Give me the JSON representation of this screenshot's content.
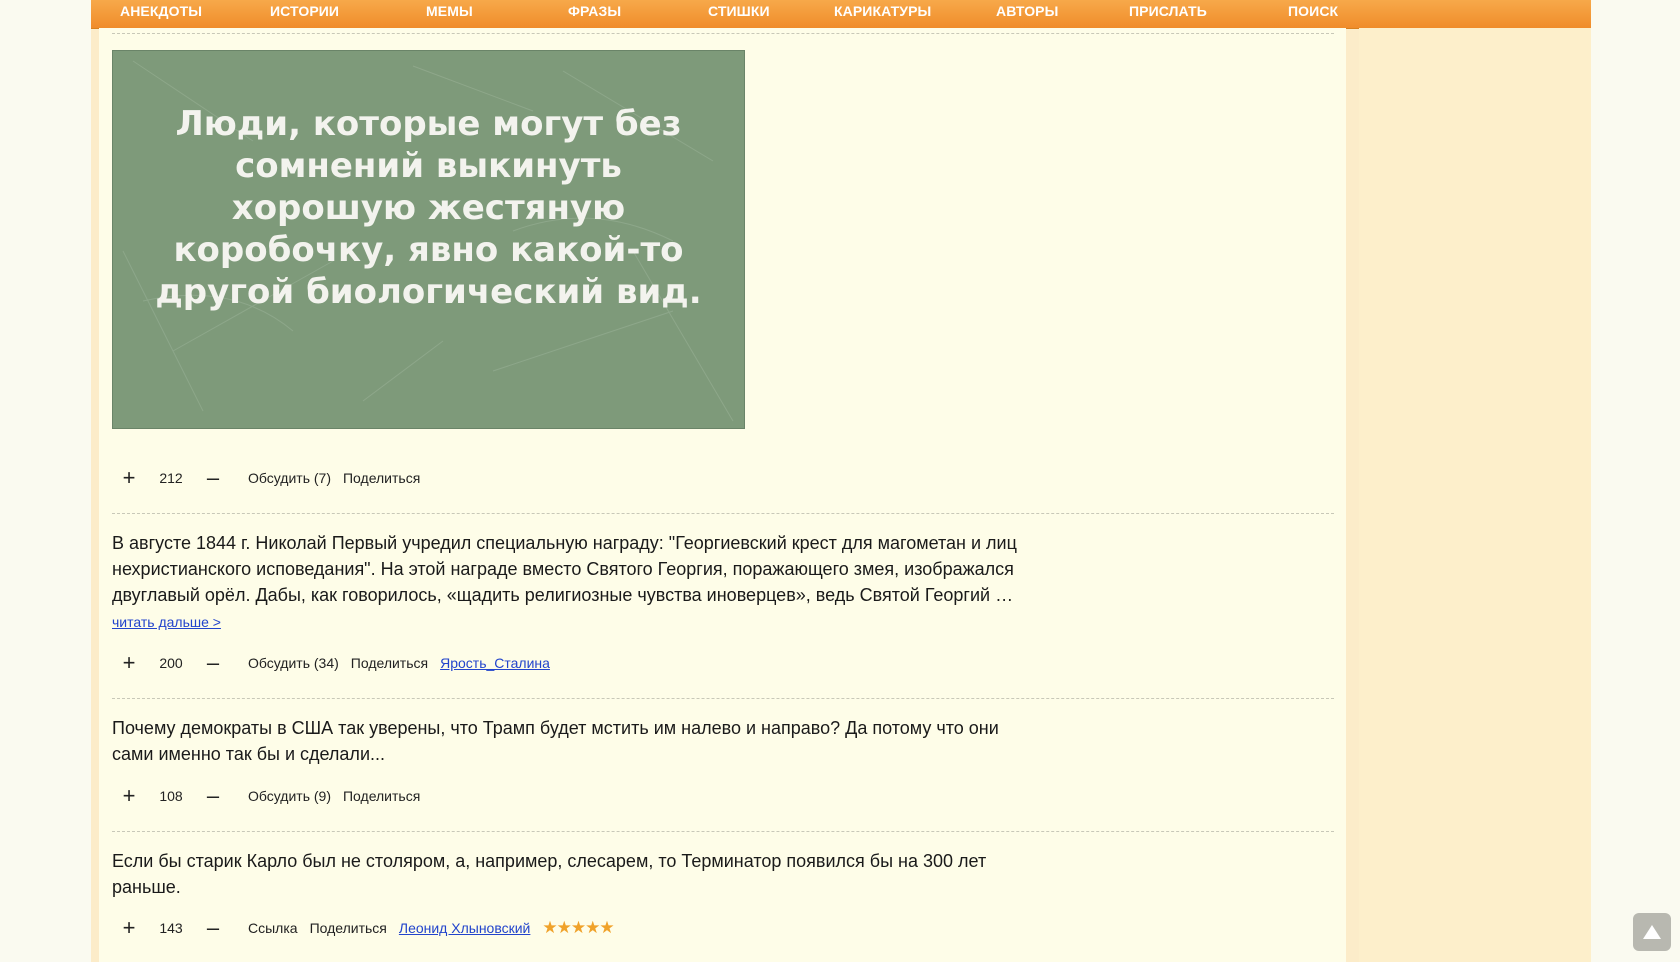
{
  "nav": [
    {
      "label": "АНЕКДОТЫ"
    },
    {
      "label": "ИСТОРИИ"
    },
    {
      "label": "МЕМЫ"
    },
    {
      "label": "ФРАЗЫ"
    },
    {
      "label": "СТИШКИ"
    },
    {
      "label": "КАРИКАТУРЫ"
    },
    {
      "label": "АВТОРЫ"
    },
    {
      "label": "ПРИСЛАТЬ"
    },
    {
      "label": "ПОИСК"
    }
  ],
  "meme": {
    "text": "Люди, которые могут без\nсомнений выкинуть\nхорошую жестяную\nкоробочку, явно какой-то\nдругой биологический вид."
  },
  "posts": [
    {
      "score": "212",
      "discuss": "Обсудить (7)",
      "share": "Поделиться"
    },
    {
      "text": "В августе 1844 г. Николай Первый учредил специальную награду: \"Георгиевский крест для магометан и лиц нехристианского исповедания\". На этой награде вместо Святого Георгия, поражающего змея, изображался двуглавый орёл. Дабы, как говорилось, «щадить религиозные чувства иноверцев», ведь Святой Георгий …",
      "read_more": "читать дальше >",
      "score": "200",
      "discuss": "Обсудить (34)",
      "share": "Поделиться",
      "author": "Ярость_Сталина"
    },
    {
      "text": "Почему демократы в США так уверены, что Трамп будет мстить им налево и направо? Да потому что они сами именно так бы и сделали...",
      "score": "108",
      "discuss": "Обсудить (9)",
      "share": "Поделиться"
    },
    {
      "text": "Если бы старик Карло был не столяром, а, например, слесарем, то Терминатор появился бы на 300 лет раньше.",
      "score": "143",
      "link": "Ссылка",
      "share": "Поделиться",
      "author": "Леонид Хлыновский",
      "stars": "★★★★★",
      "rating": 5
    }
  ],
  "vote": {
    "plus": "+",
    "minus": "–"
  },
  "colors": {
    "nav": "#f08c2a",
    "accent_star": "#f0a22a",
    "link": "#2244cc",
    "meme_bg": "#7e9a7a"
  }
}
